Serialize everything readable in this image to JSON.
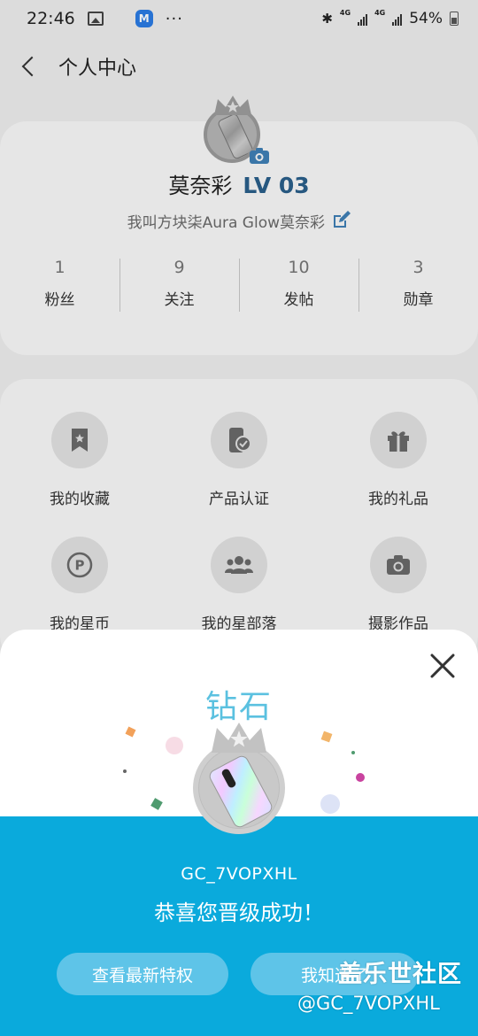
{
  "status_bar": {
    "time": "22:46",
    "app_icon_letter": "M",
    "more": "···",
    "network_1": "4G",
    "network_2": "4G",
    "battery": "54%"
  },
  "header": {
    "title": "个人中心"
  },
  "profile": {
    "nickname": "莫奈彩",
    "level": "LV 03",
    "bio": "我叫方块柒Aura Glow莫奈彩",
    "stats": [
      {
        "value": "1",
        "label": "粉丝"
      },
      {
        "value": "9",
        "label": "关注"
      },
      {
        "value": "10",
        "label": "发帖"
      },
      {
        "value": "3",
        "label": "勋章"
      }
    ]
  },
  "menu": {
    "items": [
      {
        "label": "我的收藏",
        "icon": "bookmark-icon"
      },
      {
        "label": "产品认证",
        "icon": "phone-check-icon"
      },
      {
        "label": "我的礼品",
        "icon": "gift-icon"
      },
      {
        "label": "我的星币",
        "icon": "coin-icon"
      },
      {
        "label": "我的星部落",
        "icon": "group-icon"
      },
      {
        "label": "摄影作品",
        "icon": "camera-icon"
      }
    ]
  },
  "dialog": {
    "tier": "钻石",
    "username": "GC_7VOPXHL",
    "message": "恭喜您晋级成功！",
    "primary_button": "查看最新特权",
    "secondary_button": "我知道了",
    "colors": {
      "accent": "#0aaadc",
      "tier_text": "#5bc1e0",
      "button": "#5ec4e8"
    }
  },
  "watermark": {
    "title": "盖乐世社区",
    "handle": "@GC_7VOPXHL"
  }
}
